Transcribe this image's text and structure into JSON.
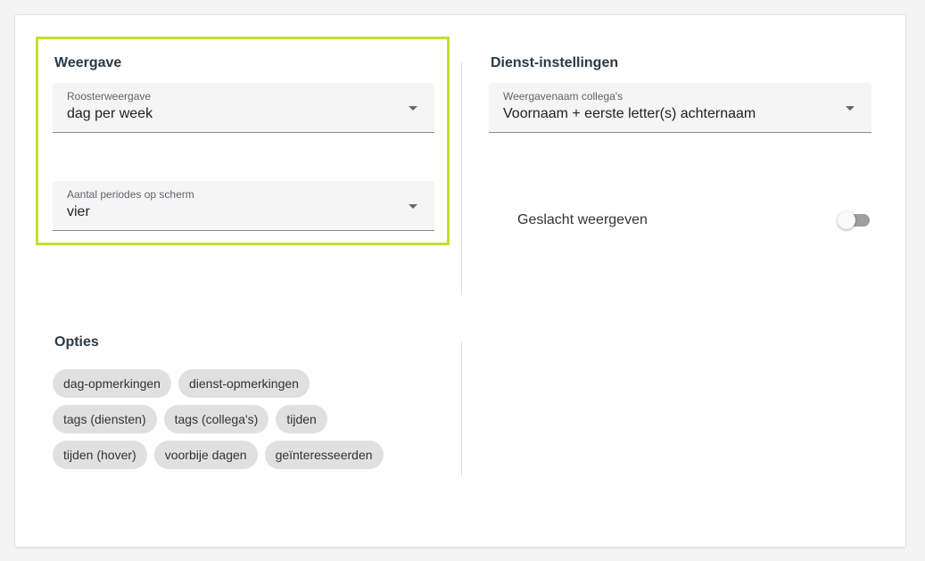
{
  "weergave": {
    "title": "Weergave",
    "rooster": {
      "label": "Roosterweergave",
      "value": "dag per week"
    },
    "periodes": {
      "label": "Aantal periodes op scherm",
      "value": "vier"
    }
  },
  "dienst": {
    "title": "Dienst-instellingen",
    "naam": {
      "label": "Weergavenaam collega's",
      "value": "Voornaam + eerste letter(s) achternaam"
    },
    "geslacht": {
      "label": "Geslacht weergeven",
      "enabled": false
    }
  },
  "opties": {
    "title": "Opties",
    "chips": [
      "dag-opmerkingen",
      "dienst-opmerkingen",
      "tags (diensten)",
      "tags (collega's)",
      "tijden",
      "tijden (hover)",
      "voorbije dagen",
      "geïnteresseerden"
    ]
  },
  "colors": {
    "highlight": "#c5e02a",
    "chip_bg": "#e0e0e0",
    "field_bg": "#f5f5f5"
  }
}
